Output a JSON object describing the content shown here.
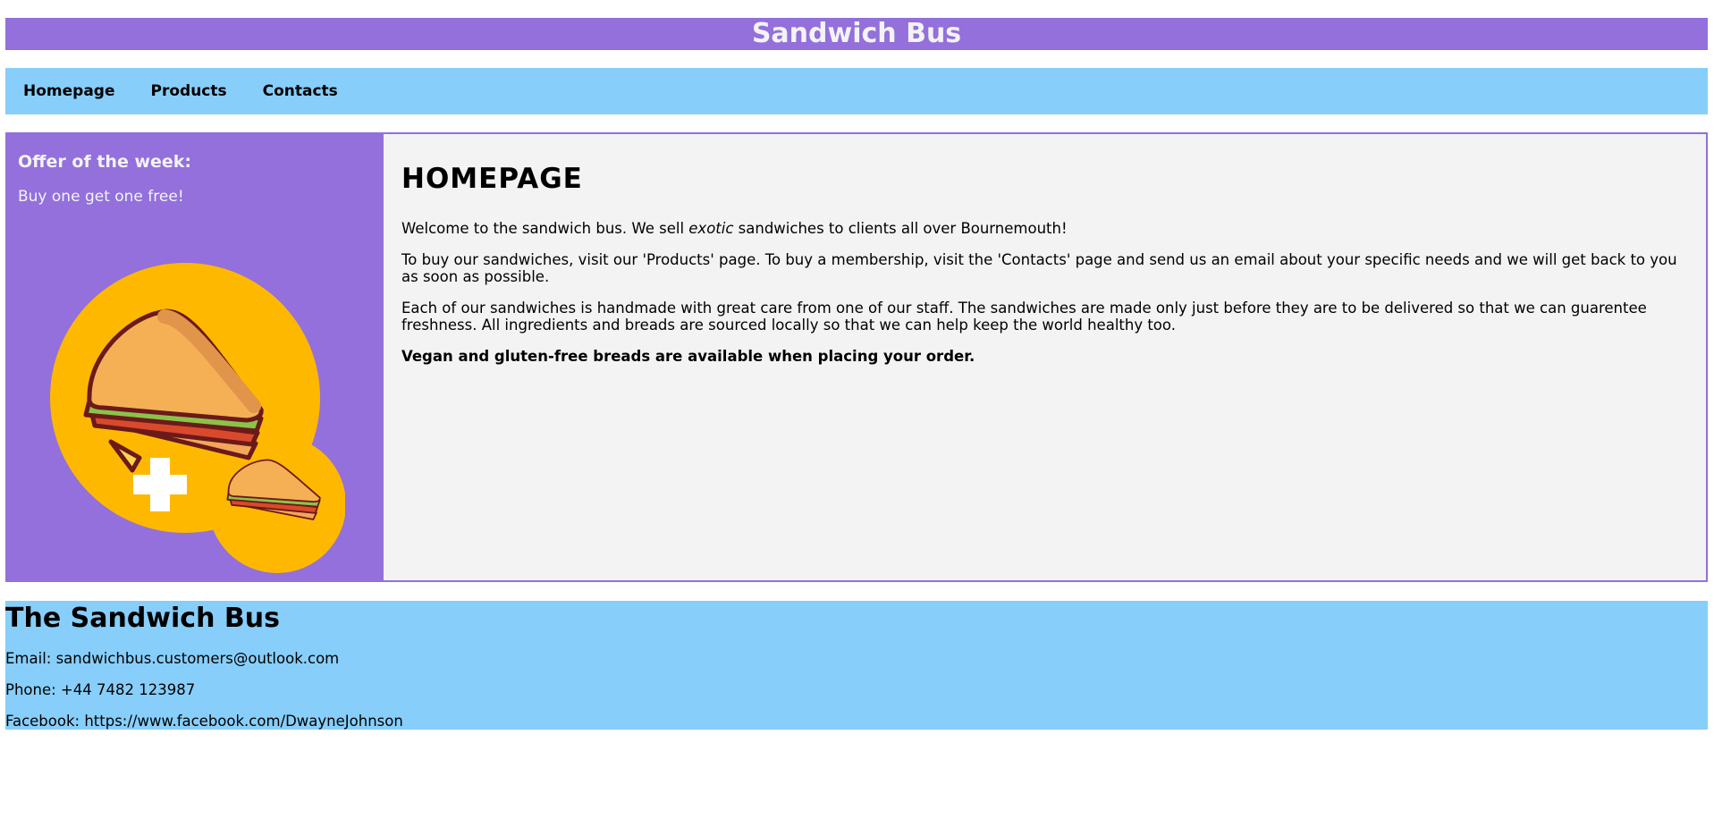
{
  "header": {
    "title": "Sandwich Bus"
  },
  "nav": {
    "items": [
      "Homepage",
      "Products",
      "Contacts"
    ]
  },
  "sidebar": {
    "heading": "Offer of the week:",
    "text": "Buy one get one free!",
    "image_icon": "sandwich-bogof-illustration"
  },
  "main": {
    "heading": "HOMEPAGE",
    "p1_before": "Welcome to the sandwich bus. We sell ",
    "p1_em": "exotic",
    "p1_after": " sandwiches to clients all over Bournemouth!",
    "p2": "To buy our sandwiches, visit our 'Products' page. To buy a membership, visit the 'Contacts' page and send us an email about your specific needs and we will get back to you as soon as possible.",
    "p3": "Each of our sandwiches is handmade with great care from one of our staff. The sandwiches are made only just before they are to be delivered so that we can guarentee freshness. All ingredients and breads are sourced locally so that we can help keep the world healthy too.",
    "p4": "Vegan and gluten-free breads are available when placing your order."
  },
  "footer": {
    "heading": "The Sandwich Bus",
    "email": "Email: sandwichbus.customers@outlook.com",
    "phone": "Phone: +44 7482 123987",
    "facebook": "Facebook: https://www.facebook.com/DwayneJohnson"
  },
  "colors": {
    "purple": "#9370DB",
    "lightblue": "#87CEFA",
    "content_bg": "#F3F3F3",
    "yellow": "#FFB800"
  }
}
